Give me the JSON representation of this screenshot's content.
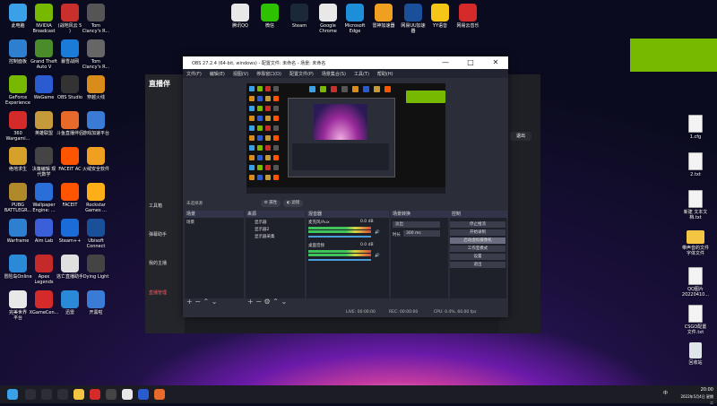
{
  "desktop": {
    "left_icons": [
      {
        "label": "此电脑",
        "color": "#3aa0e8"
      },
      {
        "label": "NVIDIA\nBroadcast",
        "color": "#76b900"
      },
      {
        "label": "(战地风云 5\n)",
        "color": "#c9302c"
      },
      {
        "label": "Tom\nClancy's R...",
        "color": "#555555"
      },
      {
        "label": "控制面板",
        "color": "#2f7fd0"
      },
      {
        "label": "Grand Theft\nAuto V",
        "color": "#4a8c2a"
      },
      {
        "label": "暴雪战网",
        "color": "#1b7bd8"
      },
      {
        "label": "Tom\nClancy's R...",
        "color": "#666666"
      },
      {
        "label": "GeForce\nExperience",
        "color": "#76b900"
      },
      {
        "label": "WeGame",
        "color": "#2a5bd0"
      },
      {
        "label": "OBS Studio",
        "color": "#333333"
      },
      {
        "label": "穿越火线",
        "color": "#d98c1a"
      },
      {
        "label": "360\nWargami...",
        "color": "#d42a2a"
      },
      {
        "label": "英雄联盟",
        "color": "#c59a3a"
      },
      {
        "label": "斗鱼直播伴侣",
        "color": "#e76a2a"
      },
      {
        "label": "游戏加速平台",
        "color": "#3a7bd5"
      },
      {
        "label": "绝地求生",
        "color": "#d6a12a"
      },
      {
        "label": "决策编辑 现\n代数学",
        "color": "#444444"
      },
      {
        "label": "FACEIT AC",
        "color": "#ff5500"
      },
      {
        "label": "火绒安全软件",
        "color": "#f0a020"
      },
      {
        "label": "PUBG\nBATTLEGR...",
        "color": "#b08a2a"
      },
      {
        "label": "Wallpaper\nEngine: ...",
        "color": "#2a6fd8"
      },
      {
        "label": "FACEIT",
        "color": "#ff5500"
      },
      {
        "label": "Rockstar\nGames ...",
        "color": "#fcaf17"
      },
      {
        "label": "Warframe",
        "color": "#2f7fd0"
      },
      {
        "label": "Aim Lab",
        "color": "#3a5fd8"
      },
      {
        "label": "Steam++",
        "color": "#1b6bd8"
      },
      {
        "label": "Ubisoft\nConnect",
        "color": "#1a4f9a"
      },
      {
        "label": "冒险岛Online",
        "color": "#2a8ad8"
      },
      {
        "label": "Apex\nLegends",
        "color": "#c42a2a"
      },
      {
        "label": "逃亡直播助手",
        "color": "#e0e0e0"
      },
      {
        "label": "Dying Light",
        "color": "#444444"
      },
      {
        "label": "完美世界\n平台",
        "color": "#e8e8e8"
      },
      {
        "label": "XGameCen...",
        "color": "#d42a2a"
      },
      {
        "label": "迅雷",
        "color": "#2a8ad8"
      },
      {
        "label": "开黑啦",
        "color": "#3a7bd5"
      }
    ],
    "top_icons": [
      {
        "label": "腾讯QQ",
        "color": "#e8e8e8"
      },
      {
        "label": "微信",
        "color": "#2dc100"
      },
      {
        "label": "Steam",
        "color": "#1b2838"
      },
      {
        "label": "Google\nChrome",
        "color": "#e8e8e8"
      },
      {
        "label": "Microsoft\nEdge",
        "color": "#1c8fd8"
      },
      {
        "label": "雷神加速器",
        "color": "#f0a020"
      },
      {
        "label": "网易UU加速\n器",
        "color": "#1a4f9a"
      },
      {
        "label": "YY语音",
        "color": "#f5c518"
      },
      {
        "label": "网易云音乐",
        "color": "#d42a2a"
      }
    ],
    "right_icons": [
      {
        "label": "1.cfg",
        "kind": "file"
      },
      {
        "label": "2.txt",
        "kind": "file"
      },
      {
        "label": "新建 文本文\n档.txt",
        "kind": "file"
      },
      {
        "label": "带声音的文件\n字体文件",
        "kind": "folder"
      },
      {
        "label": "QQ图片\n20220410...",
        "kind": "file"
      },
      {
        "label": "CSGO配置\n文件.txt",
        "kind": "file"
      },
      {
        "label": "回收站",
        "kind": "recycle"
      }
    ]
  },
  "bg_app": {
    "logo": "直播伴",
    "side_items": [
      "工具箱",
      "弹幕助手",
      "我的主播",
      "直播管理"
    ],
    "right_button": "退出"
  },
  "obs": {
    "title": "OBS 27.2.4 (64-bit, windows) - 配置文件: 未命名 - 场景: 未命名",
    "menu": [
      "文件(F)",
      "编辑(E)",
      "视图(V)",
      "停靠窗口(D)",
      "配置文件(P)",
      "场景集合(S)",
      "工具(T)",
      "帮助(H)"
    ],
    "no_source": "未选择源",
    "props_button": "属性",
    "filter_button": "滤镜",
    "docks": {
      "scenes": "场景",
      "sources": "来源",
      "mixer": "混音器",
      "transitions": "场景转换",
      "controls": "控制"
    },
    "scene_items": [
      "场景"
    ],
    "source_items": [
      "显示器",
      "显示器2",
      "显示器采集"
    ],
    "mixer_channels": [
      {
        "name": "麦克风/Aux",
        "value": "0.0 dB"
      },
      {
        "name": "桌面音频",
        "value": "0.0 dB"
      }
    ],
    "transition": {
      "type": "淡出",
      "duration_label": "时长",
      "duration": "300 ms"
    },
    "controls": [
      "停止推流",
      "开始录制",
      "启动虚拟摄像机",
      "工作室模式",
      "设置",
      "退出"
    ],
    "status": {
      "live": "LIVE: 00:00:00",
      "rec": "REC: 00:00:00",
      "cpu": "CPU: 0.4%, 60.00 fps"
    },
    "window_buttons": {
      "min": "—",
      "max": "□",
      "close": "✕"
    }
  },
  "taskbar": {
    "time": "20:00",
    "date": "2022年5月4日 星期二",
    "tray_lang": "中"
  }
}
